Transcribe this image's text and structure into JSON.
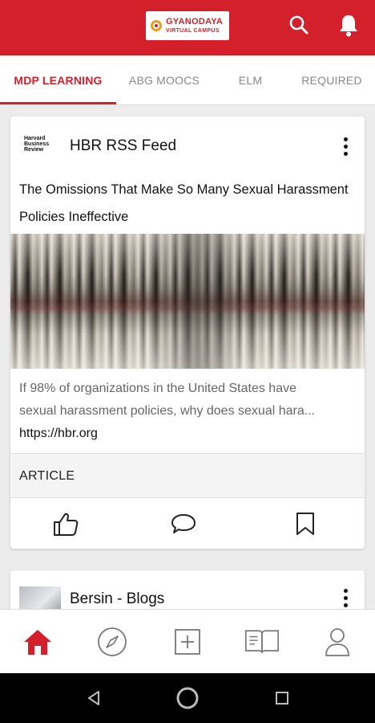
{
  "header": {
    "logo_line1": "GYANODAYA",
    "logo_line2": "VIRTUAL CAMPUS",
    "brand_color": "#d4202b"
  },
  "tabs": [
    {
      "label": "MDP LEARNING",
      "active": true
    },
    {
      "label": "ABG MOOCS",
      "active": false
    },
    {
      "label": "ELM",
      "active": false
    },
    {
      "label": "REQUIRED",
      "active": false
    }
  ],
  "feed": {
    "card1": {
      "source_logo_l1": "Harvard",
      "source_logo_l2": "Business",
      "source_logo_l3": "Review",
      "source_name": "HBR RSS Feed",
      "title": "The Omissions That Make So Many Sexual Harassment Policies Ineffective",
      "description_l1": "If 98% of organizations in the United States have",
      "description_l2": "sexual harassment policies, why does sexual hara...",
      "link": "https://hbr.org",
      "type": "ARTICLE"
    },
    "card2": {
      "source_name": "Bersin - Blogs"
    }
  },
  "icons": {
    "search": "search-icon",
    "bell": "bell-icon",
    "like": "thumbs-up-icon",
    "comment": "comment-icon",
    "bookmark": "bookmark-icon",
    "home": "home-icon",
    "explore": "compass-icon",
    "add": "add-square-icon",
    "library": "open-book-icon",
    "profile": "person-icon"
  }
}
